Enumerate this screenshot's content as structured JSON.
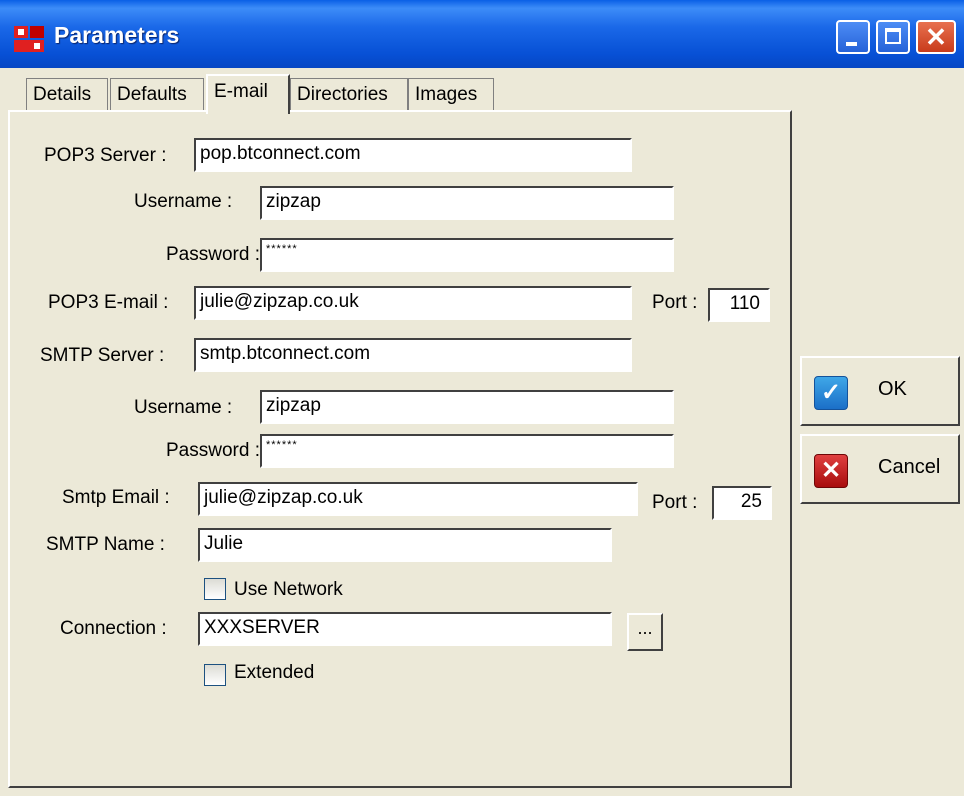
{
  "window": {
    "title": "Parameters"
  },
  "tabs": [
    {
      "label": "Details"
    },
    {
      "label": "Defaults"
    },
    {
      "label": "E-mail"
    },
    {
      "label": "Directories"
    },
    {
      "label": "Images"
    }
  ],
  "email": {
    "pop3_server_label": "POP3 Server :",
    "pop3_server_value": "pop.btconnect.com",
    "pop3_username_label": "Username :",
    "pop3_username_value": "zipzap",
    "pop3_password_label": "Password :",
    "pop3_password_value": "******",
    "pop3_email_label": "POP3 E-mail :",
    "pop3_email_value": "julie@zipzap.co.uk",
    "pop3_port_label": "Port :",
    "pop3_port_value": "110",
    "smtp_server_label": "SMTP Server :",
    "smtp_server_value": "smtp.btconnect.com",
    "smtp_username_label": "Username :",
    "smtp_username_value": "zipzap",
    "smtp_password_label": "Password :",
    "smtp_password_value": "******",
    "smtp_email_label": "Smtp Email :",
    "smtp_email_value": "julie@zipzap.co.uk",
    "smtp_port_label": "Port :",
    "smtp_port_value": "25",
    "smtp_name_label": "SMTP Name :",
    "smtp_name_value": "Julie",
    "use_network_label": "Use Network",
    "use_network_checked": false,
    "connection_label": "Connection :",
    "connection_value": "XXXSERVER",
    "browse_label": "...",
    "extended_label": "Extended",
    "extended_checked": false
  },
  "buttons": {
    "ok_label": "OK",
    "cancel_label": "Cancel"
  },
  "icons": {
    "app": "app-icon",
    "ok": "check-icon",
    "cancel": "x-icon"
  }
}
